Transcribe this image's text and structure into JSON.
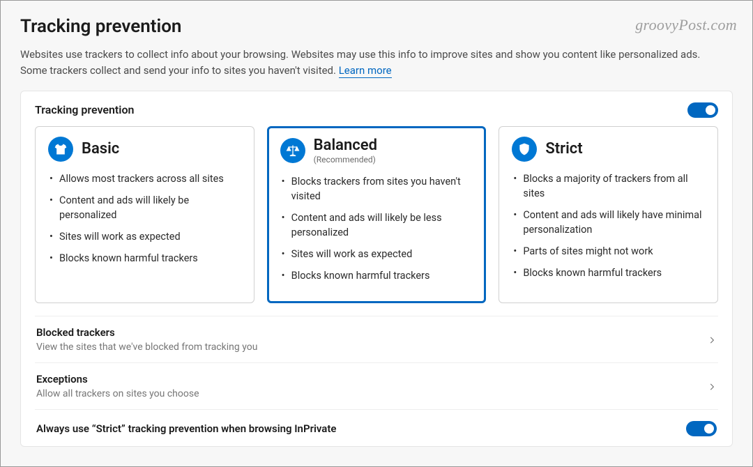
{
  "watermark": "groovyPost.com",
  "page": {
    "title": "Tracking prevention",
    "description_prefix": "Websites use trackers to collect info about your browsing. Websites may use this info to improve sites and show you content like personalized ads. Some trackers collect and send your info to sites you haven't visited. ",
    "learn_more": "Learn more"
  },
  "panel": {
    "header": "Tracking prevention",
    "toggle_on": true
  },
  "cards": {
    "basic": {
      "title": "Basic",
      "subtitle": "",
      "items": [
        "Allows most trackers across all sites",
        "Content and ads will likely be personalized",
        "Sites will work as expected",
        "Blocks known harmful trackers"
      ]
    },
    "balanced": {
      "title": "Balanced",
      "subtitle": "(Recommended)",
      "items": [
        "Blocks trackers from sites you haven't visited",
        "Content and ads will likely be less personalized",
        "Sites will work as expected",
        "Blocks known harmful trackers"
      ]
    },
    "strict": {
      "title": "Strict",
      "subtitle": "",
      "items": [
        "Blocks a majority of trackers from all sites",
        "Content and ads will likely have minimal personalization",
        "Parts of sites might not work",
        "Blocks known harmful trackers"
      ]
    }
  },
  "rows": {
    "blocked": {
      "title": "Blocked trackers",
      "sub": "View the sites that we've blocked from tracking you"
    },
    "exceptions": {
      "title": "Exceptions",
      "sub": "Allow all trackers on sites you choose"
    },
    "inprivate": {
      "title": "Always use “Strict” tracking prevention when browsing InPrivate"
    }
  },
  "colors": {
    "accent": "#0067c0"
  }
}
